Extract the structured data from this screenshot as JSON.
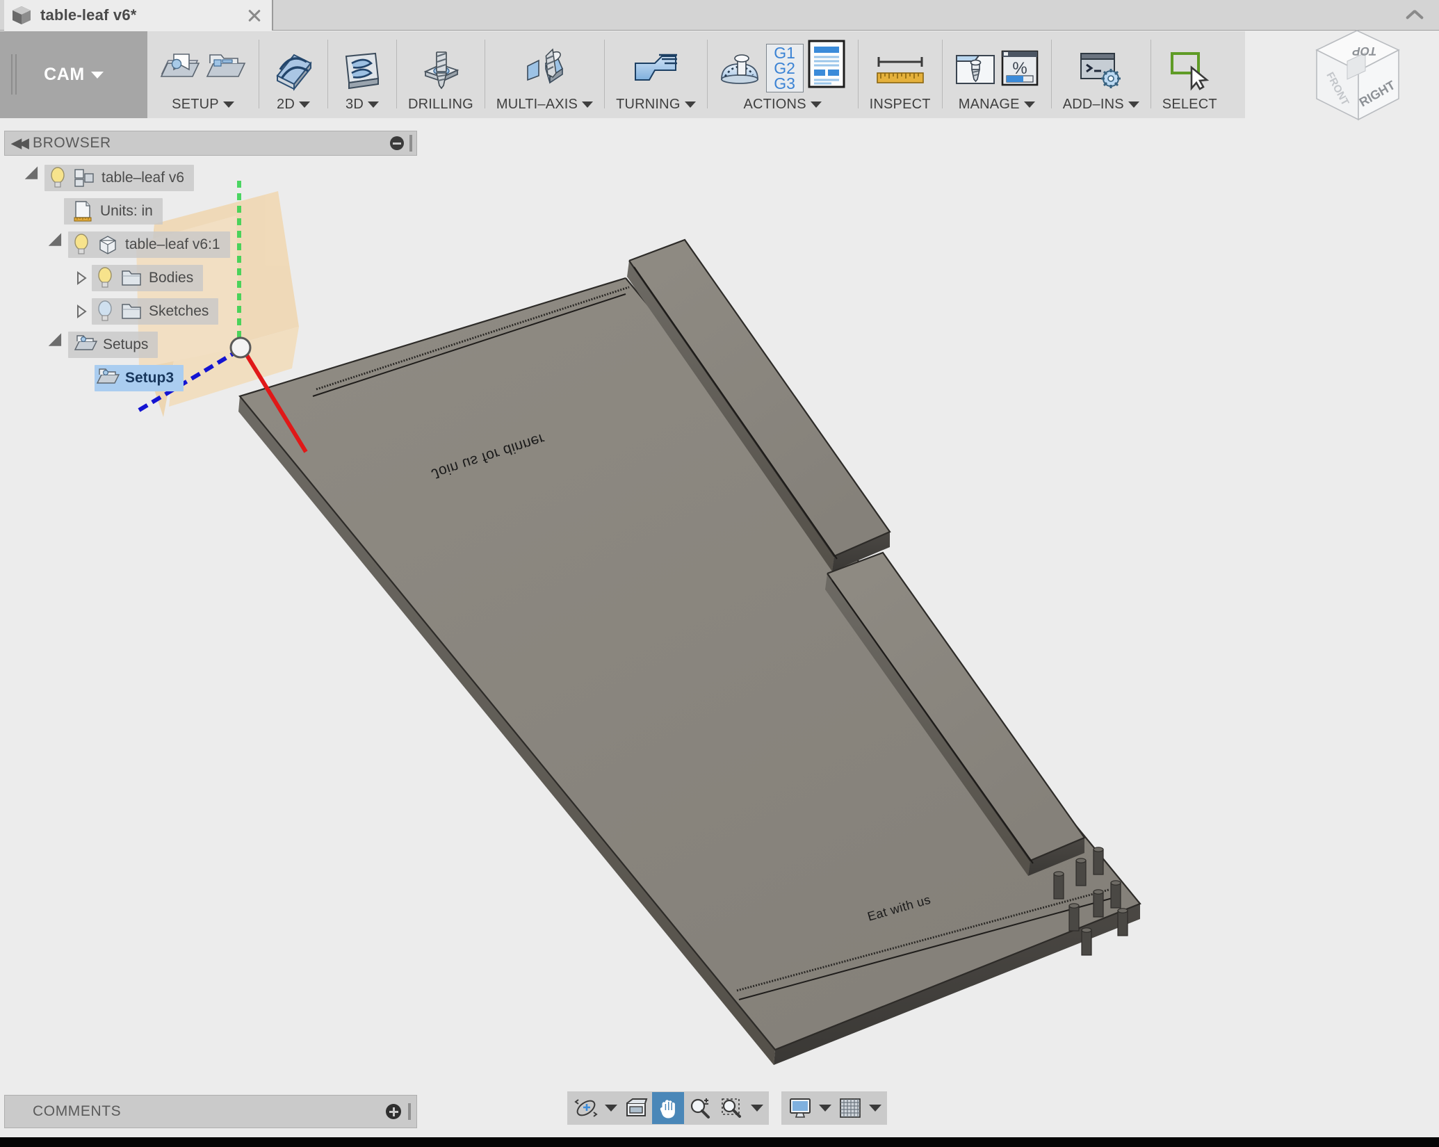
{
  "window": {
    "tab_title": "table-leaf v6*",
    "tab_icon": "cube-icon",
    "close_icon": "close-icon",
    "collapse_ribbon_icon": "chevron-up-icon"
  },
  "ribbon": {
    "workspace": {
      "label": "CAM",
      "has_dropdown": true
    },
    "panels": [
      {
        "name": "setup",
        "label": "SETUP",
        "has_dropdown": true,
        "icons": [
          "new-setup-icon",
          "folder-setup-icon"
        ]
      },
      {
        "name": "2d",
        "label": "2D",
        "has_dropdown": true,
        "icons": [
          "2d-toolpath-icon"
        ]
      },
      {
        "name": "3d",
        "label": "3D",
        "has_dropdown": true,
        "icons": [
          "3d-toolpath-icon"
        ]
      },
      {
        "name": "drilling",
        "label": "DRILLING",
        "has_dropdown": false,
        "icons": [
          "drill-icon"
        ]
      },
      {
        "name": "multi-axis",
        "label": "MULTI–AXIS",
        "has_dropdown": true,
        "icons": [
          "multi-axis-icon"
        ]
      },
      {
        "name": "turning",
        "label": "TURNING",
        "has_dropdown": true,
        "icons": [
          "turning-icon"
        ]
      },
      {
        "name": "actions",
        "label": "ACTIONS",
        "has_dropdown": true,
        "icons": [
          "simulate-icon",
          "post-process-icon",
          "setup-sheet-icon"
        ]
      },
      {
        "name": "inspect",
        "label": "INSPECT",
        "has_dropdown": false,
        "icons": [
          "measure-icon"
        ]
      },
      {
        "name": "manage",
        "label": "MANAGE",
        "has_dropdown": true,
        "icons": [
          "tool-library-icon",
          "machining-time-icon"
        ]
      },
      {
        "name": "add-ins",
        "label": "ADD–INS",
        "has_dropdown": true,
        "icons": [
          "script-addin-icon"
        ]
      },
      {
        "name": "select",
        "label": "SELECT",
        "has_dropdown": false,
        "icons": [
          "select-cursor-icon"
        ]
      }
    ],
    "g_code_lines": [
      "G1",
      "G2",
      "G3"
    ],
    "percent_symbol": "%",
    "prompt_symbol": ">–"
  },
  "browser": {
    "header": {
      "title": "BROWSER",
      "collapse_icon": "collapse-left-icon",
      "minimize_icon": "minimize-icon",
      "grip_icon": "grip-icon"
    },
    "items": [
      {
        "label": "table–leaf v6",
        "indent": 0,
        "expander": "down",
        "bulb": "on",
        "icon": "assembly-icon",
        "selected": false
      },
      {
        "label": "Units: in",
        "indent": 1,
        "expander": "none",
        "bulb": "none",
        "icon": "units-icon",
        "selected": false
      },
      {
        "label": "table–leaf v6:1",
        "indent": 1,
        "expander": "down",
        "bulb": "on",
        "icon": "component-icon",
        "selected": false
      },
      {
        "label": "Bodies",
        "indent": 2,
        "expander": "right",
        "bulb": "on",
        "icon": "folder-icon",
        "selected": false
      },
      {
        "label": "Sketches",
        "indent": 2,
        "expander": "right",
        "bulb": "dim",
        "icon": "folder-icon",
        "selected": false
      },
      {
        "label": "Setups",
        "indent": 1,
        "expander": "down",
        "bulb": "none",
        "icon": "setup-folder-icon",
        "selected": false
      },
      {
        "label": "Setup3",
        "indent": 2,
        "expander": "none",
        "bulb": "none",
        "icon": "setup-folder-icon",
        "selected": true
      }
    ]
  },
  "canvas": {
    "engravings": [
      {
        "text": "Join us for dinner",
        "id": "engrave-top"
      },
      {
        "text": "Eat with us",
        "id": "engrave-bottom"
      }
    ],
    "wcs": {
      "z_axis_color": "#2fd14a",
      "x_axis_color": "#1414d2",
      "y_axis_color": "#e01818",
      "stock_color": "#f2cf99"
    },
    "model_color": "#8c8880",
    "background_color": "#ececec",
    "dowel_count": 8
  },
  "viewcube": {
    "faces": [
      "TOP",
      "RIGHT",
      "FRONT"
    ],
    "top_label": "TOP",
    "right_label": "RIGHT",
    "front_label": "FRONT"
  },
  "footer": {
    "comments": {
      "title": "COMMENTS",
      "add_icon": "add-comment-icon",
      "grip_icon": "grip-icon"
    },
    "navbar": [
      {
        "name": "orbit",
        "icon": "orbit-icon",
        "has_dropdown": true,
        "active": false
      },
      {
        "name": "look-at",
        "icon": "look-at-icon",
        "has_dropdown": false,
        "active": false
      },
      {
        "name": "pan",
        "icon": "pan-hand-icon",
        "has_dropdown": false,
        "active": true
      },
      {
        "name": "zoom",
        "icon": "zoom-in-icon",
        "has_dropdown": false,
        "active": false
      },
      {
        "name": "zoom-window",
        "icon": "zoom-window-icon",
        "has_dropdown": true,
        "active": false
      },
      {
        "name": "display-settings",
        "icon": "monitor-icon",
        "has_dropdown": true,
        "active": false
      },
      {
        "name": "grid-snaps",
        "icon": "grid-icon",
        "has_dropdown": true,
        "active": false
      }
    ]
  }
}
